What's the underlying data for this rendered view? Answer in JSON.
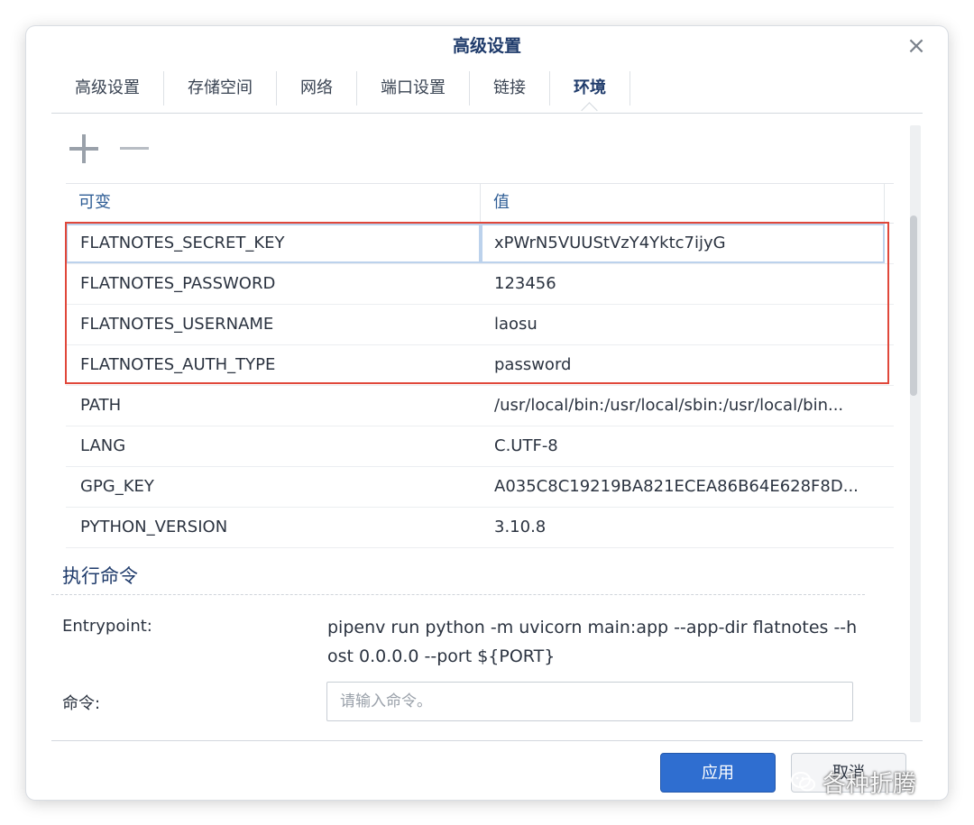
{
  "dialog": {
    "title": "高级设置",
    "close_icon": "×"
  },
  "tabs": [
    {
      "label": "高级设置",
      "active": false
    },
    {
      "label": "存储空间",
      "active": false
    },
    {
      "label": "网络",
      "active": false
    },
    {
      "label": "端口设置",
      "active": false
    },
    {
      "label": "链接",
      "active": false
    },
    {
      "label": "环境",
      "active": true
    }
  ],
  "toolbar": {
    "add_icon": "plus-icon",
    "remove_icon": "minus-icon"
  },
  "env_table": {
    "headers": [
      "可变",
      "值"
    ],
    "rows": [
      {
        "name": "FLATNOTES_SECRET_KEY",
        "value": "xPWrN5VUUStVzY4Yktc7ijyG"
      },
      {
        "name": "FLATNOTES_PASSWORD",
        "value": "123456"
      },
      {
        "name": "FLATNOTES_USERNAME",
        "value": "laosu"
      },
      {
        "name": "FLATNOTES_AUTH_TYPE",
        "value": "password"
      },
      {
        "name": "PATH",
        "value": "/usr/local/bin:/usr/local/sbin:/usr/local/bin..."
      },
      {
        "name": "LANG",
        "value": "C.UTF-8"
      },
      {
        "name": "GPG_KEY",
        "value": "A035C8C19219BA821ECEA86B64E628F8D..."
      },
      {
        "name": "PYTHON_VERSION",
        "value": "3.10.8"
      }
    ]
  },
  "exec": {
    "section_title": "执行命令",
    "entrypoint_label": "Entrypoint:",
    "entrypoint_value": "pipenv run python -m uvicorn main:app --app-dir flatnotes --host 0.0.0.0 --port ${PORT}",
    "command_label": "命令:",
    "command_placeholder": "请输入命令。",
    "command_value": ""
  },
  "footer": {
    "apply_label": "应用",
    "cancel_label": "取消"
  },
  "watermark": {
    "text": "各种折腾"
  },
  "colors": {
    "accent": "#2f6ed0",
    "highlight": "#e0473a",
    "title": "#1f3b6b"
  }
}
